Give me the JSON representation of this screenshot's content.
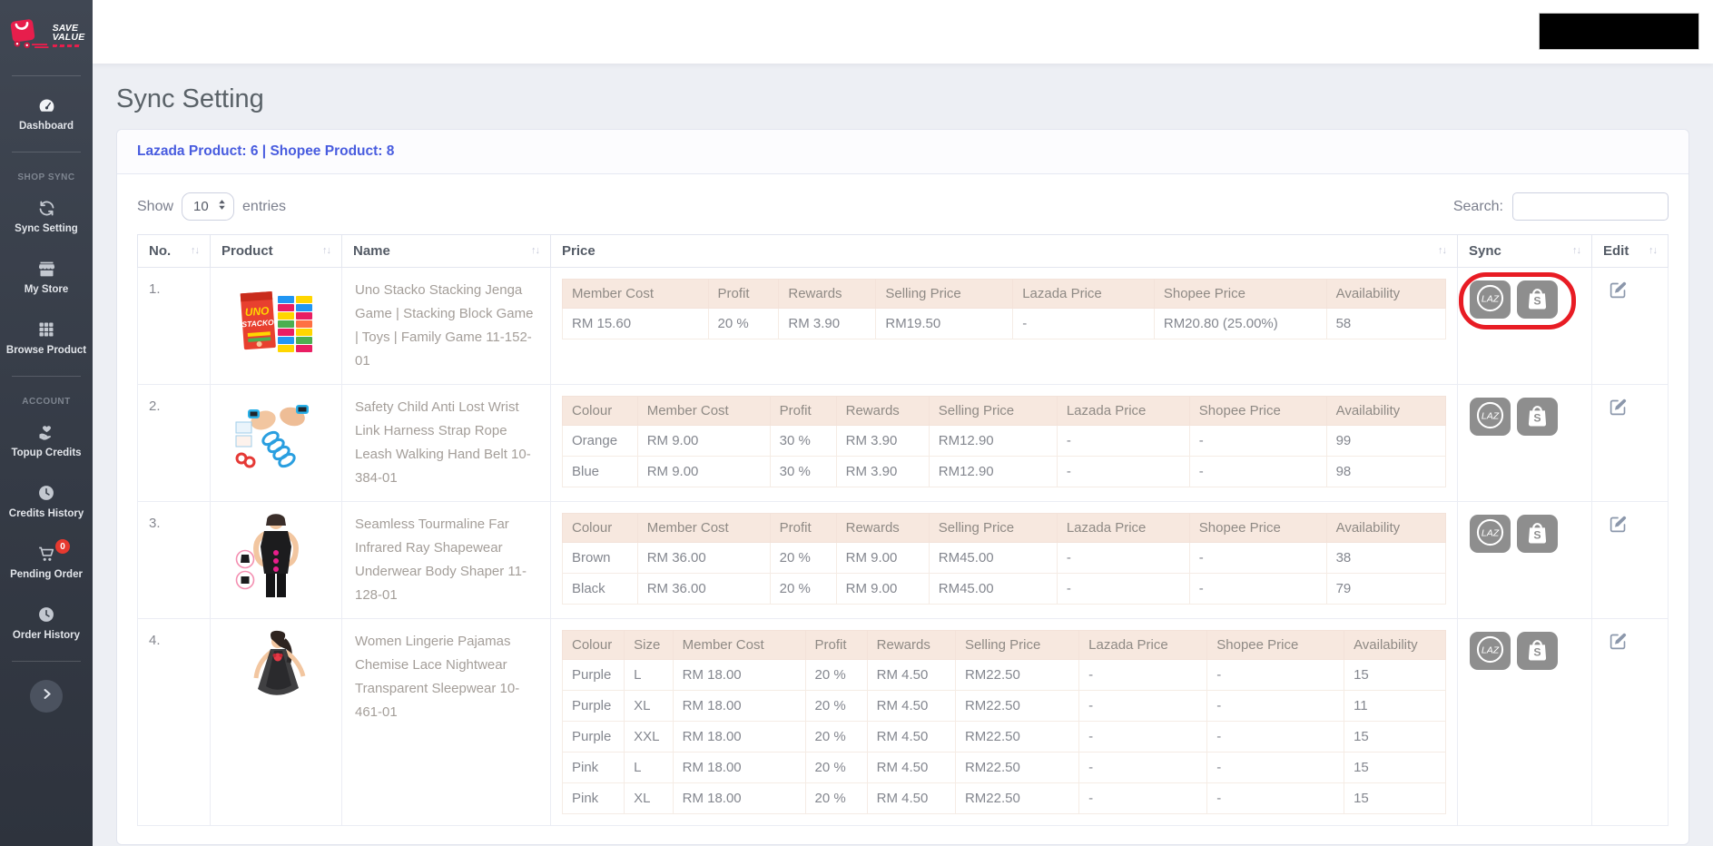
{
  "sidebar": {
    "logo": {
      "line1": "SAVE",
      "line2": "VALUE"
    },
    "sections": [
      {
        "title": "",
        "items": [
          {
            "label": "Dashboard",
            "icon": "speedometer"
          }
        ]
      },
      {
        "title": "SHOP SYNC",
        "items": [
          {
            "label": "Sync Setting",
            "icon": "sync"
          },
          {
            "label": "My Store",
            "icon": "store"
          },
          {
            "label": "Browse Product",
            "icon": "grid"
          }
        ]
      },
      {
        "title": "ACCOUNT",
        "items": [
          {
            "label": "Topup Credits",
            "icon": "hand-heart"
          },
          {
            "label": "Credits History",
            "icon": "clock"
          },
          {
            "label": "Pending Order",
            "icon": "cart",
            "badge": "0"
          },
          {
            "label": "Order History",
            "icon": "clock"
          }
        ]
      }
    ]
  },
  "page": {
    "title": "Sync Setting"
  },
  "card": {
    "header": "Lazada Product: 6 | Shopee Product: 8"
  },
  "controls": {
    "show": "Show",
    "page_size": "10",
    "entries": "entries",
    "search": "Search:",
    "search_value": ""
  },
  "table": {
    "columns": [
      "No.",
      "Product",
      "Name",
      "Price",
      "Sync",
      "Edit"
    ],
    "sync_buttons": [
      {
        "icon": "lazada",
        "label": "LAZ"
      },
      {
        "icon": "shopee",
        "label": "S"
      }
    ],
    "rows": [
      {
        "no": "1.",
        "image": "uno-stacko-game",
        "name": "Uno Stacko Stacking Jenga Game | Stacking Block Game | Toys | Family Game 11-152-01",
        "price": {
          "headers": [
            "Member Cost",
            "Profit",
            "Rewards",
            "Selling Price",
            "Lazada Price",
            "Shopee Price",
            "Availability"
          ],
          "rows": [
            [
              "RM 15.60",
              "20 %",
              "RM 3.90",
              "RM19.50",
              "-",
              "RM20.80 (25.00%)",
              "58"
            ]
          ]
        },
        "annotated": true
      },
      {
        "no": "2.",
        "image": "anti-lost-wrist-link",
        "name": "Safety Child Anti Lost Wrist Link Harness Strap Rope Leash Walking Hand Belt 10-384-01",
        "price": {
          "headers": [
            "Colour",
            "Member Cost",
            "Profit",
            "Rewards",
            "Selling Price",
            "Lazada Price",
            "Shopee Price",
            "Availability"
          ],
          "rows": [
            [
              "Orange",
              "RM 9.00",
              "30 %",
              "RM 3.90",
              "RM12.90",
              "-",
              "-",
              "99"
            ],
            [
              "Blue",
              "RM 9.00",
              "30 %",
              "RM 3.90",
              "RM12.90",
              "-",
              "-",
              "98"
            ]
          ]
        },
        "annotated": false
      },
      {
        "no": "3.",
        "image": "shapewear-body-shaper",
        "name": "Seamless Tourmaline Far Infrared Ray Shapewear Underwear Body Shaper 11-128-01",
        "price": {
          "headers": [
            "Colour",
            "Member Cost",
            "Profit",
            "Rewards",
            "Selling Price",
            "Lazada Price",
            "Shopee Price",
            "Availability"
          ],
          "rows": [
            [
              "Brown",
              "RM 36.00",
              "20 %",
              "RM 9.00",
              "RM45.00",
              "-",
              "-",
              "38"
            ],
            [
              "Black",
              "RM 36.00",
              "20 %",
              "RM 9.00",
              "RM45.00",
              "-",
              "-",
              "79"
            ]
          ]
        },
        "annotated": false
      },
      {
        "no": "4.",
        "image": "lingerie-sleepwear",
        "name": "Women Lingerie Pajamas Chemise Lace Nightwear Transparent Sleepwear 10-461-01",
        "price": {
          "headers": [
            "Colour",
            "Size",
            "Member Cost",
            "Profit",
            "Rewards",
            "Selling Price",
            "Lazada Price",
            "Shopee Price",
            "Availability"
          ],
          "rows": [
            [
              "Purple",
              "L",
              "RM 18.00",
              "20 %",
              "RM 4.50",
              "RM22.50",
              "-",
              "-",
              "15"
            ],
            [
              "Purple",
              "XL",
              "RM 18.00",
              "20 %",
              "RM 4.50",
              "RM22.50",
              "-",
              "-",
              "11"
            ],
            [
              "Purple",
              "XXL",
              "RM 18.00",
              "20 %",
              "RM 4.50",
              "RM22.50",
              "-",
              "-",
              "15"
            ],
            [
              "Pink",
              "L",
              "RM 18.00",
              "20 %",
              "RM 4.50",
              "RM22.50",
              "-",
              "-",
              "15"
            ],
            [
              "Pink",
              "XL",
              "RM 18.00",
              "20 %",
              "RM 4.50",
              "RM22.50",
              "-",
              "-",
              "15"
            ]
          ]
        },
        "annotated": false
      }
    ]
  },
  "colors": {
    "accent_blue": "#485cdf",
    "annotation_red": "#e81c24",
    "badge_red": "#e6392f",
    "subtable_header_bg": "#f7e8df",
    "sidebar_dark": "#353b46",
    "brand_red": "#e71e4c"
  }
}
